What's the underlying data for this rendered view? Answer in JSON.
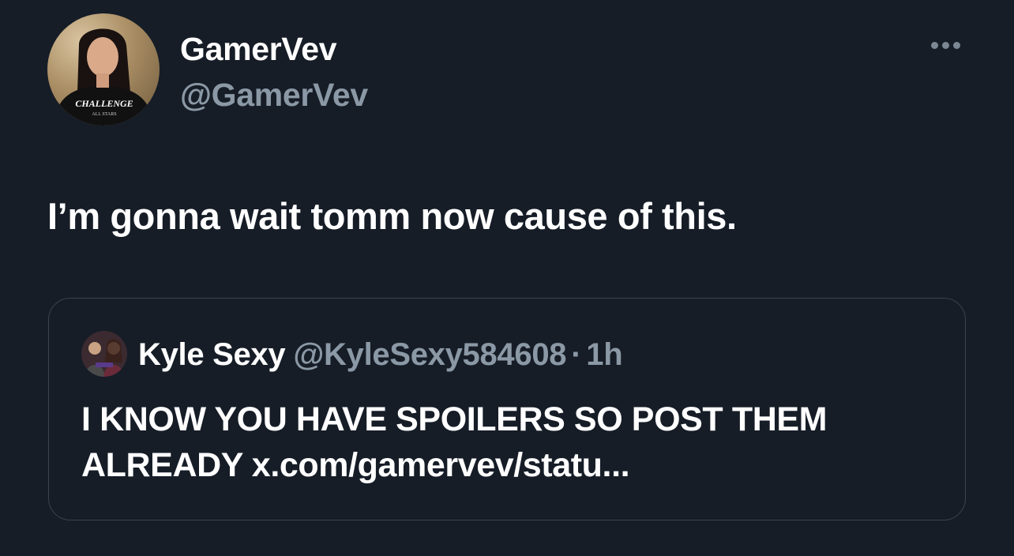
{
  "author": {
    "display_name": "GamerVev",
    "handle": "@GamerVev",
    "avatar_shirt_text": "CHALLENGE",
    "avatar_shirt_subtext": "ALL STARS"
  },
  "more_icon": "more-horizontal-icon",
  "tweet": {
    "text": "I’m gonna wait tomm now cause of this."
  },
  "quoted": {
    "display_name": "Kyle Sexy",
    "handle": "@KyleSexy584608",
    "separator": "·",
    "time": "1h",
    "text": "I KNOW YOU HAVE SPOILERS SO POST THEM ALREADY x.com/gamervev/statu..."
  },
  "colors": {
    "background": "#161d27",
    "text_primary": "#ffffff",
    "text_secondary": "#8b98a5",
    "border": "#3a444f"
  }
}
